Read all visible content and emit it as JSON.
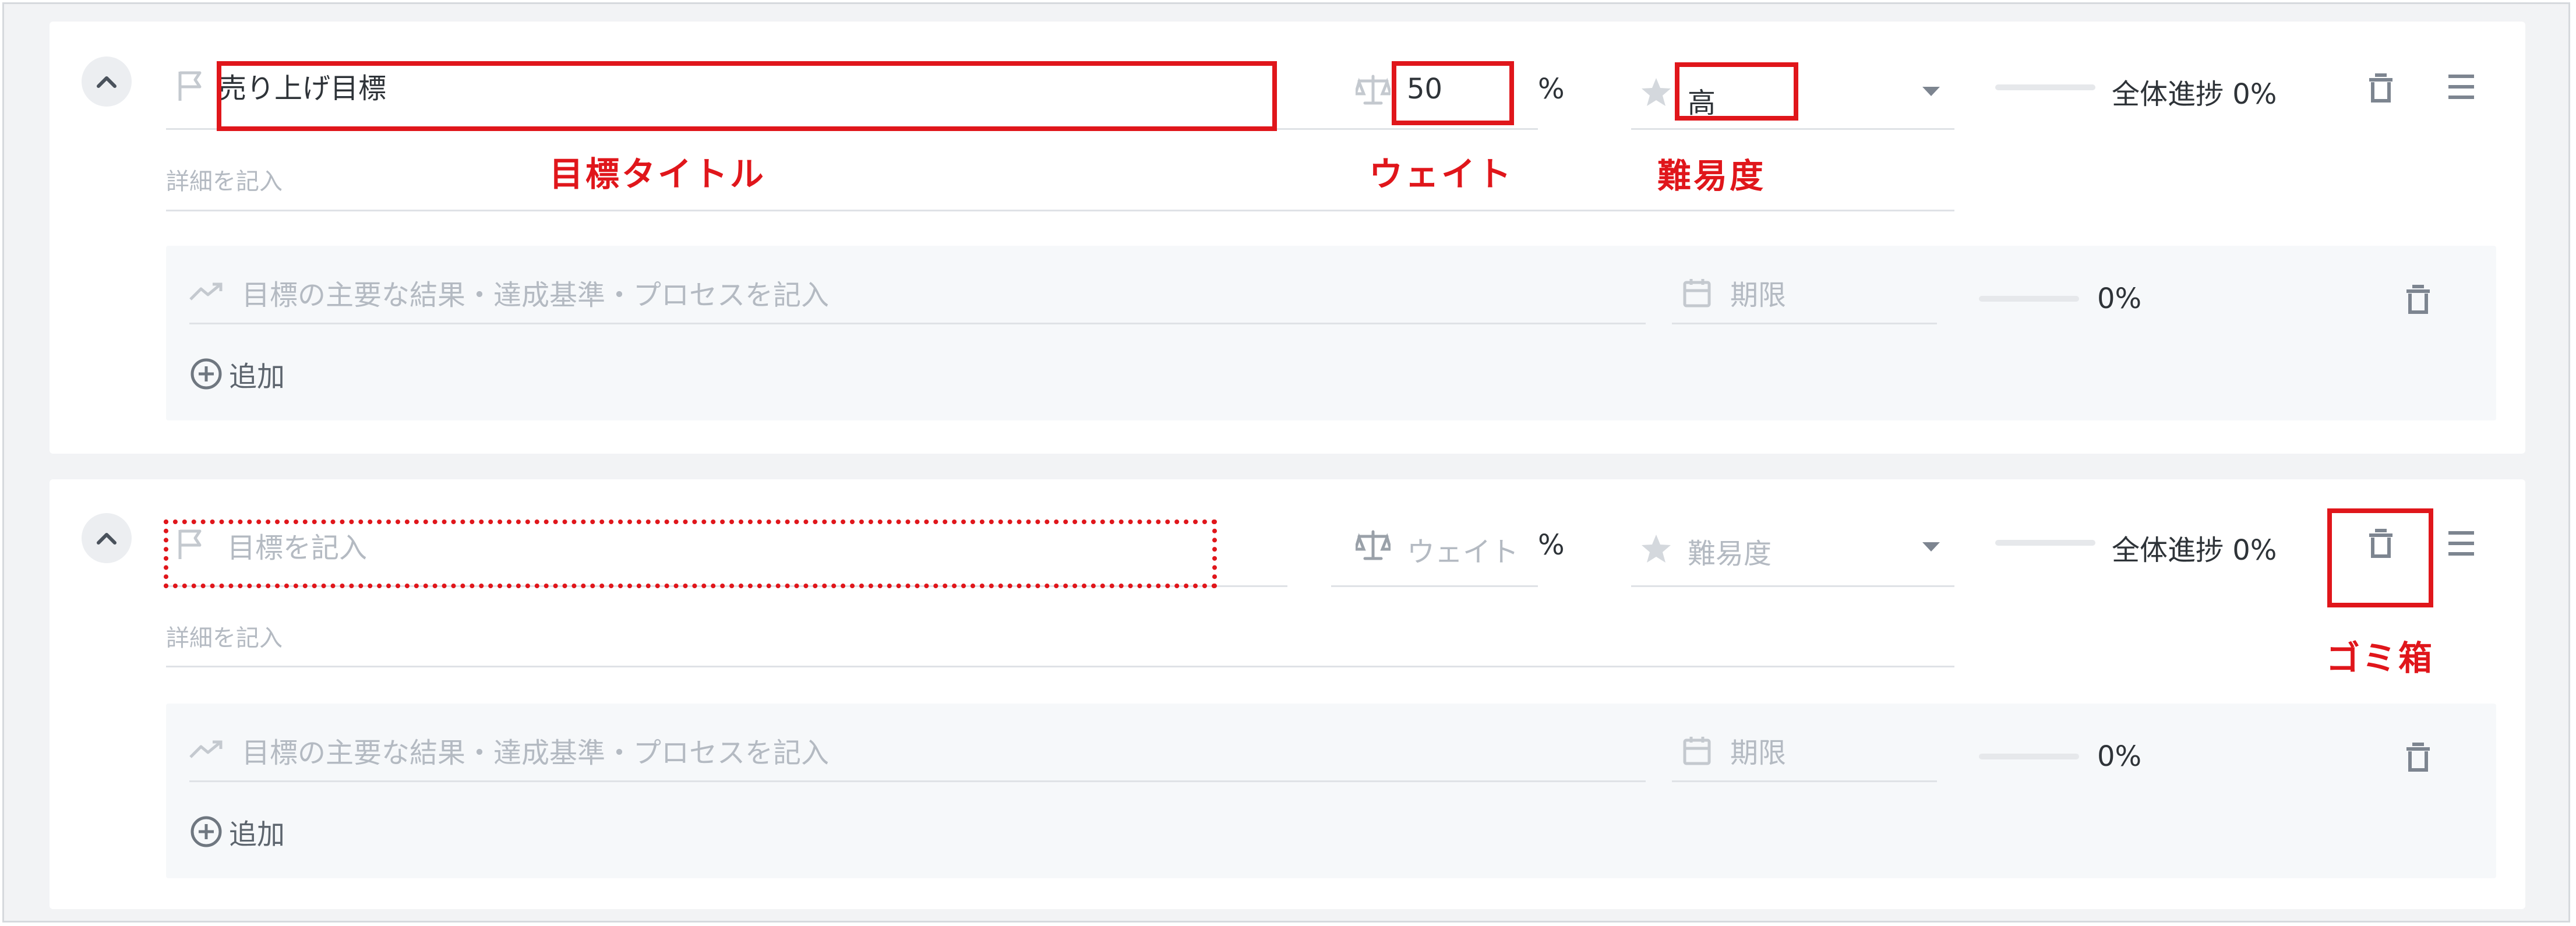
{
  "goals": [
    {
      "title_value": "売り上げ目標",
      "title_placeholder": "目標を記入",
      "detail_placeholder": "詳細を記入",
      "weight_value": "50",
      "weight_placeholder": "ウェイト",
      "percent_sign": "%",
      "difficulty_value": "高",
      "difficulty_placeholder": "難易度",
      "progress_label": "全体進捗 0%",
      "progress_fraction": 0,
      "key_result": {
        "placeholder": "目標の主要な結果・達成基準・プロセスを記入",
        "deadline_placeholder": "期限",
        "progress_label": "0%",
        "add_label": "追加"
      }
    },
    {
      "title_value": "",
      "title_placeholder": "目標を記入",
      "detail_placeholder": "詳細を記入",
      "weight_value": "",
      "weight_placeholder": "ウェイト",
      "percent_sign": "%",
      "difficulty_value": "",
      "difficulty_placeholder": "難易度",
      "progress_label": "全体進捗 0%",
      "progress_fraction": 0,
      "key_result": {
        "placeholder": "目標の主要な結果・達成基準・プロセスを記入",
        "deadline_placeholder": "期限",
        "progress_label": "0%",
        "add_label": "追加"
      }
    }
  ],
  "annotations": {
    "title": "目標タイトル",
    "weight": "ウェイト",
    "difficulty": "難易度",
    "trash": "ゴミ箱"
  },
  "colors": {
    "annotation_red": "#e0161b",
    "placeholder_gray": "#b4bac2",
    "icon_gray": "#7d8590",
    "panel_bg": "#f6f8fa"
  },
  "icons": [
    "chevron-up-icon",
    "flag-icon",
    "scale-icon",
    "star-icon",
    "caret-down-icon",
    "trash-icon",
    "menu-icon",
    "trend-icon",
    "calendar-icon",
    "add-circle-icon"
  ]
}
